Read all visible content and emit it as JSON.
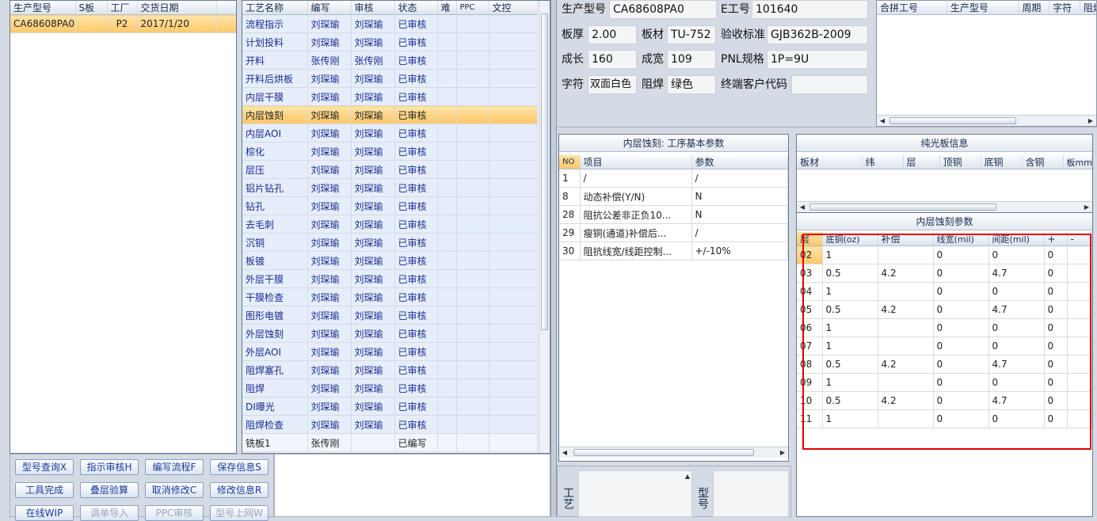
{
  "orders": {
    "headers": [
      "生产型号",
      "S板",
      "工厂",
      "交货日期"
    ],
    "rows": [
      {
        "model": "CA68608PA0",
        "s": "",
        "factory": "P2",
        "date": "2017/1/20"
      }
    ]
  },
  "process": {
    "headers": [
      "工艺名称",
      "编写",
      "审核",
      "状态",
      "难",
      "PPC",
      "文控"
    ],
    "rows": [
      [
        "流程指示",
        "刘琛瑜",
        "刘琛瑜",
        "已审核"
      ],
      [
        "计划投料",
        "刘琛瑜",
        "刘琛瑜",
        "已审核"
      ],
      [
        "开料",
        "张传刚",
        "张传刚",
        "已审核"
      ],
      [
        "开料后烘板",
        "刘琛瑜",
        "刘琛瑜",
        "已审核"
      ],
      [
        "内层干膜",
        "刘琛瑜",
        "刘琛瑜",
        "已审核"
      ],
      [
        "内层蚀刻",
        "刘琛瑜",
        "刘琛瑜",
        "已审核"
      ],
      [
        "内层AOI",
        "刘琛瑜",
        "刘琛瑜",
        "已审核"
      ],
      [
        "棕化",
        "刘琛瑜",
        "刘琛瑜",
        "已审核"
      ],
      [
        "层压",
        "刘琛瑜",
        "刘琛瑜",
        "已审核"
      ],
      [
        "铝片钻孔",
        "刘琛瑜",
        "刘琛瑜",
        "已审核"
      ],
      [
        "钻孔",
        "刘琛瑜",
        "刘琛瑜",
        "已审核"
      ],
      [
        "去毛刺",
        "刘琛瑜",
        "刘琛瑜",
        "已审核"
      ],
      [
        "沉铜",
        "刘琛瑜",
        "刘琛瑜",
        "已审核"
      ],
      [
        "板镀",
        "刘琛瑜",
        "刘琛瑜",
        "已审核"
      ],
      [
        "外层干膜",
        "刘琛瑜",
        "刘琛瑜",
        "已审核"
      ],
      [
        "干膜检查",
        "刘琛瑜",
        "刘琛瑜",
        "已审核"
      ],
      [
        "图形电镀",
        "刘琛瑜",
        "刘琛瑜",
        "已审核"
      ],
      [
        "外层蚀刻",
        "刘琛瑜",
        "刘琛瑜",
        "已审核"
      ],
      [
        "外层AOI",
        "刘琛瑜",
        "刘琛瑜",
        "已审核"
      ],
      [
        "阻焊塞孔",
        "刘琛瑜",
        "刘琛瑜",
        "已审核"
      ],
      [
        "阻焊",
        "刘琛瑜",
        "刘琛瑜",
        "已审核"
      ],
      [
        "DI曝光",
        "刘琛瑜",
        "刘琛瑜",
        "已审核"
      ],
      [
        "阻焊检查",
        "刘琛瑜",
        "刘琛瑜",
        "已审核"
      ],
      [
        "铣板1",
        "张传刚",
        "",
        "已编写"
      ]
    ],
    "selected_index": 5
  },
  "buttons": {
    "row1": [
      "型号查询X",
      "指示审核H",
      "编写流程F",
      "保存信息S"
    ],
    "row2": [
      "工具完成",
      "叠层验算",
      "取消修改C",
      "修改信息R"
    ],
    "row3": [
      "在线WIP",
      "调单导入",
      "PPC审核",
      "型号上网W"
    ]
  },
  "info": {
    "model_label": "生产型号",
    "model": "CA68608PA0",
    "e_label": "E工号",
    "e_no": "101640",
    "thick_label": "板厚",
    "thick": "2.00",
    "mat_label": "板材",
    "mat": "TU-752",
    "std_label": "验收标准",
    "std": "GJB362B-2009",
    "len_label": "成长",
    "len": "160",
    "wid_label": "成宽",
    "wid": "109",
    "pnl_label": "PNL规格",
    "pnl": "1P=9U",
    "char_label": "字符",
    "char": "双面白色",
    "mask_label": "阻焊",
    "mask": "绿色",
    "cust_label": "终端客户代码",
    "cust": ""
  },
  "combine": {
    "headers": [
      "合拼工号",
      "生产型号",
      "周期",
      "字符",
      "阻焊"
    ]
  },
  "params": {
    "title": "内层蚀刻: 工序基本参数",
    "headers": [
      "NO",
      "项目",
      "参数"
    ],
    "rows": [
      [
        "1",
        "/",
        "/"
      ],
      [
        "8",
        "动态补偿(Y/N)",
        "N"
      ],
      [
        "28",
        "阻抗公差非正负10...",
        "N"
      ],
      [
        "29",
        "瘦铜(通道)补偿后...",
        "/"
      ],
      [
        "30",
        "阻抗线宽/线距控制...",
        "+/-10%"
      ]
    ]
  },
  "bare": {
    "title": "纯光板信息",
    "headers": [
      "板材",
      "纬",
      "层",
      "顶铜",
      "底铜",
      "含铜",
      "板mm"
    ]
  },
  "etch": {
    "title": "内层蚀刻参数",
    "headers": [
      "层",
      "底铜(oz)",
      "补偿",
      "线宽(mil)",
      "间距(mil)",
      "+",
      "-"
    ],
    "rows": [
      [
        "02",
        "1",
        "",
        "0",
        "0",
        "0"
      ],
      [
        "03",
        "0.5",
        "4.2",
        "0",
        "4.7",
        "0"
      ],
      [
        "04",
        "1",
        "",
        "0",
        "0",
        "0"
      ],
      [
        "05",
        "0.5",
        "4.2",
        "0",
        "4.7",
        "0"
      ],
      [
        "06",
        "1",
        "",
        "0",
        "0",
        "0"
      ],
      [
        "07",
        "1",
        "",
        "0",
        "0",
        "0"
      ],
      [
        "08",
        "0.5",
        "4.2",
        "0",
        "4.7",
        "0"
      ],
      [
        "09",
        "1",
        "",
        "0",
        "0",
        "0"
      ],
      [
        "10",
        "0.5",
        "4.2",
        "0",
        "4.7",
        "0"
      ],
      [
        "11",
        "1",
        "",
        "0",
        "0",
        "0"
      ]
    ]
  },
  "bottom": {
    "label_a": "工艺",
    "label_b": "型号"
  },
  "colors": {
    "highlight": "#ff0000",
    "selected": "#ffc76a"
  }
}
